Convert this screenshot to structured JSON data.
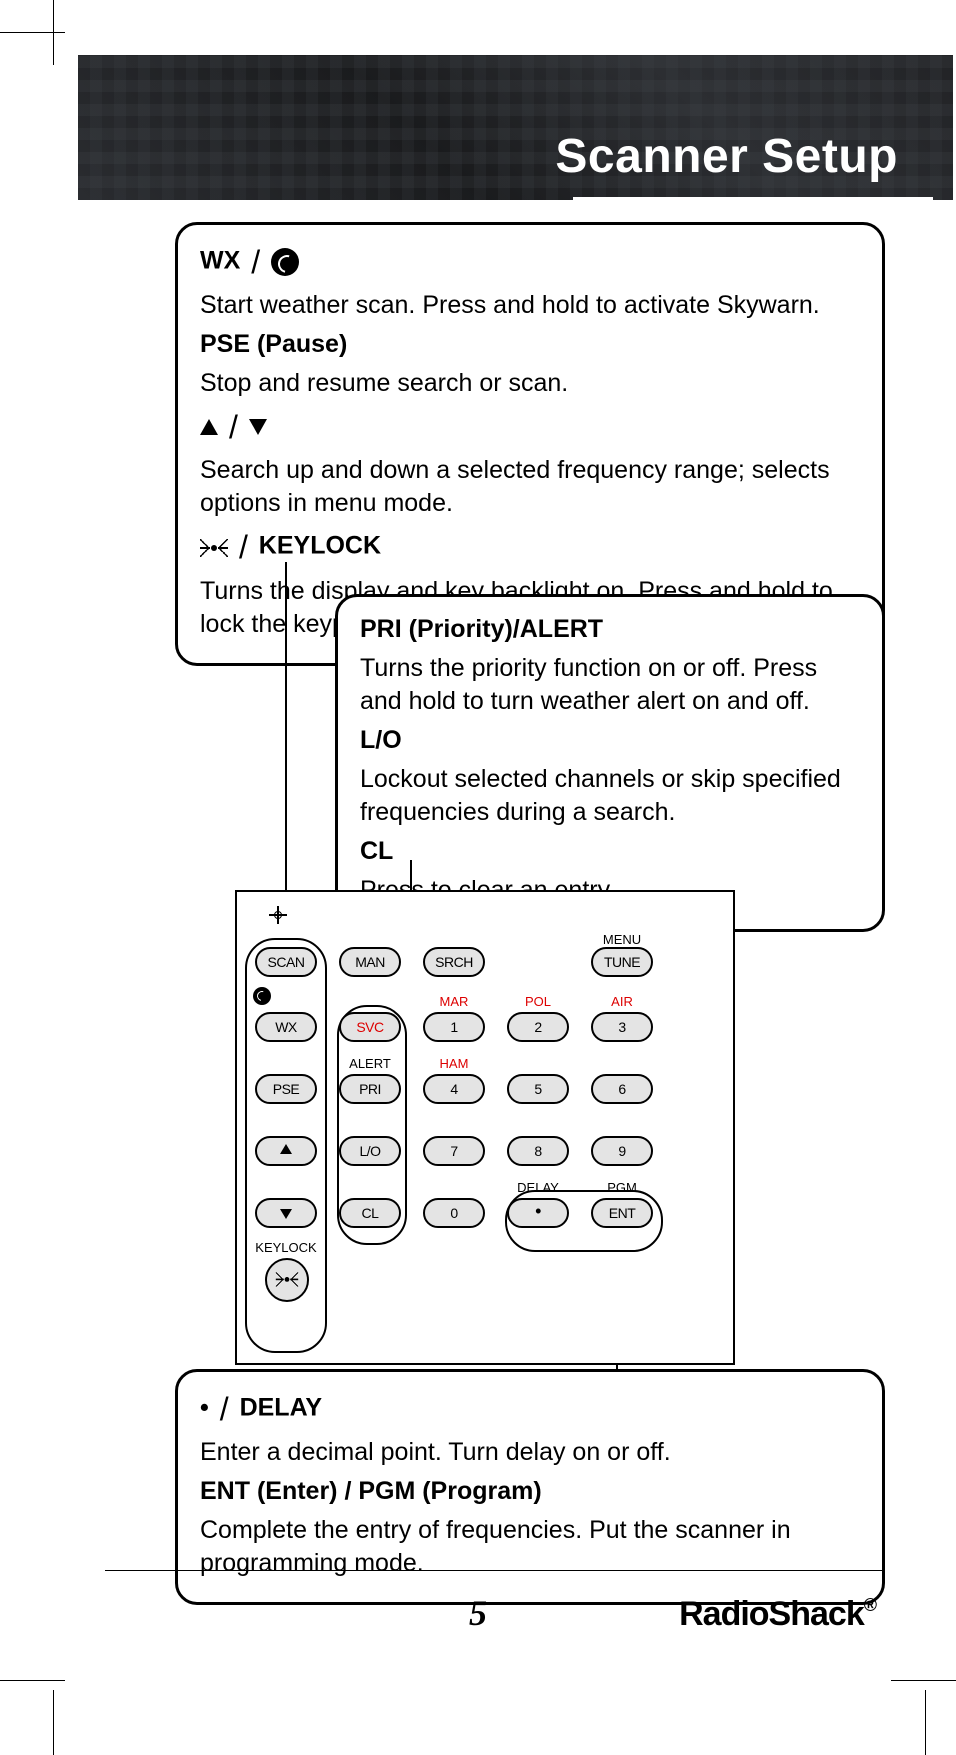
{
  "header": {
    "title": "Scanner Setup"
  },
  "box1": {
    "h1_prefix": "WX",
    "p1": "Start weather scan. Press and hold to activate Skywarn.",
    "h2": "PSE (Pause)",
    "p2": "Stop and resume search or scan.",
    "p3": "Search up and down a selected frequency range; selects options in menu mode.",
    "h4_suffix": "KEYLOCK",
    "p4": "Turns the display and key backlight on. Press and hold to lock the keypad."
  },
  "box2": {
    "h1": "PRI (Priority)/ALERT",
    "p1": "Turns the priority function on or off. Press and hold to turn weather alert on and off.",
    "h2": "L/O",
    "p2": "Lockout selected channels or skip specified frequencies during a search.",
    "h3": "CL",
    "p3": "Press to clear an entry."
  },
  "box3": {
    "h1_suffix": "DELAY",
    "p1": "Enter a decimal point. Turn delay on or off.",
    "h2": "ENT (Enter) / PGM (Program)",
    "p2": "Complete the entry of frequencies. Put the scanner in programming mode."
  },
  "keypad": {
    "scan": "SCAN",
    "man": "MAN",
    "srch": "SRCH",
    "tune": "TUNE",
    "menu": "MENU",
    "wx": "WX",
    "svc": "SVC",
    "pse": "PSE",
    "pri": "PRI",
    "alert": "ALERT",
    "lo": "L/O",
    "cl": "CL",
    "keylock": "KEYLOCK",
    "mar": "MAR",
    "pol": "POL",
    "air": "AIR",
    "ham": "HAM",
    "n1": "1",
    "n2": "2",
    "n3": "3",
    "n4": "4",
    "n5": "5",
    "n6": "6",
    "n7": "7",
    "n8": "8",
    "n9": "9",
    "n0": "0",
    "dot": "•",
    "delay": "DELAY",
    "ent": "ENT",
    "pgm": "PGM"
  },
  "footer": {
    "page": "5",
    "brand": "RadioShack"
  }
}
